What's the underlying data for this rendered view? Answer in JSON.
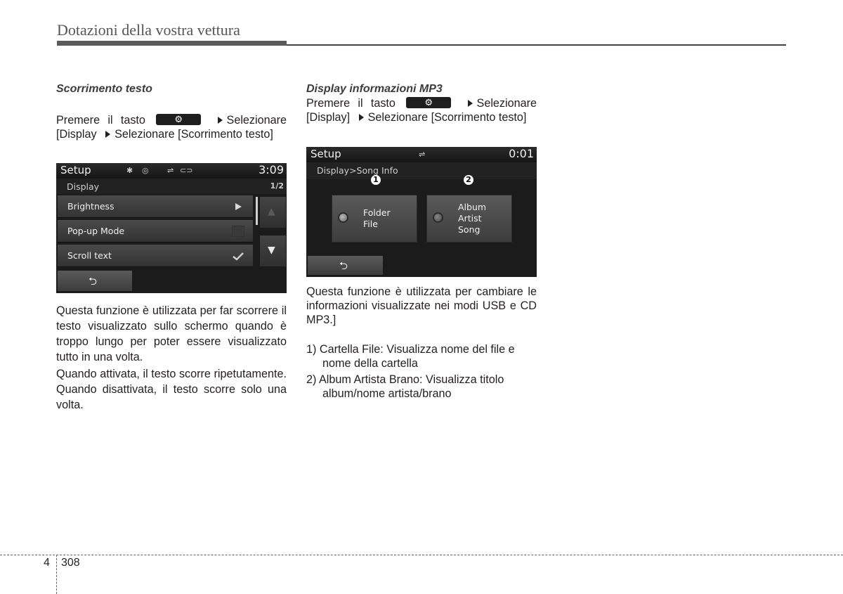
{
  "header": {
    "title": "Dotazioni della vostra vettura"
  },
  "left": {
    "heading": "Scorrimento testo",
    "instr": {
      "a": "Premere il tasto",
      "key_icon": "⚙",
      "b": "Selezionare",
      "c": "[Display",
      "d": "Selezionare [Scorrimento testo]"
    },
    "screen": {
      "title": "Setup",
      "status_icons": {
        "bluetooth": "✱",
        "disc": "◎",
        "usb": "⇌",
        "aux": "⊂⊃"
      },
      "time": "3:09",
      "section": "Display",
      "page": "1/2",
      "rows": [
        {
          "label": "Brightness",
          "control": "arrow"
        },
        {
          "label": "Pop-up Mode",
          "control": "checkbox",
          "checked": false
        },
        {
          "label": "Scroll text",
          "control": "checkbox",
          "checked": true
        }
      ],
      "up_icon": "▲",
      "down_icon": "▼",
      "back_icon": "⮌"
    },
    "para1": "Questa funzione è utilizzata per far scorrere il testo visualizzato sullo schermo quando è troppo lungo per poter essere visualizzato tutto in una volta.",
    "para2": "Quando attivata, il testo scorre ripetutamente. Quando disattivata, il testo scorre solo una volta."
  },
  "right": {
    "heading": "Display informazioni MP3",
    "instr": {
      "a": "Premere il tasto",
      "key_icon": "⚙",
      "b": "Selezionare",
      "c": "[Display]",
      "d": "Selezionare [Scorrimento testo]"
    },
    "screen": {
      "title": "Setup",
      "usb_icon": "⇌",
      "time": "0:01",
      "breadcrumb": "Display>Song Info",
      "markers": [
        "1",
        "2"
      ],
      "options": [
        {
          "lines": [
            "Folder",
            "File"
          ],
          "selected": true
        },
        {
          "lines": [
            "Album",
            "Artist",
            "Song"
          ],
          "selected": false
        }
      ],
      "back_icon": "⮌"
    },
    "para1": "Questa funzione è utilizzata per cambiare le informazioni visualizzate nei modi USB e CD MP3.]",
    "list": [
      "1) Cartella File: Visualizza nome del file e nome della cartella",
      "2) Album Artista Brano: Visualizza titolo album/nome artista/brano"
    ]
  },
  "footer": {
    "chapter": "4",
    "page": "308"
  }
}
